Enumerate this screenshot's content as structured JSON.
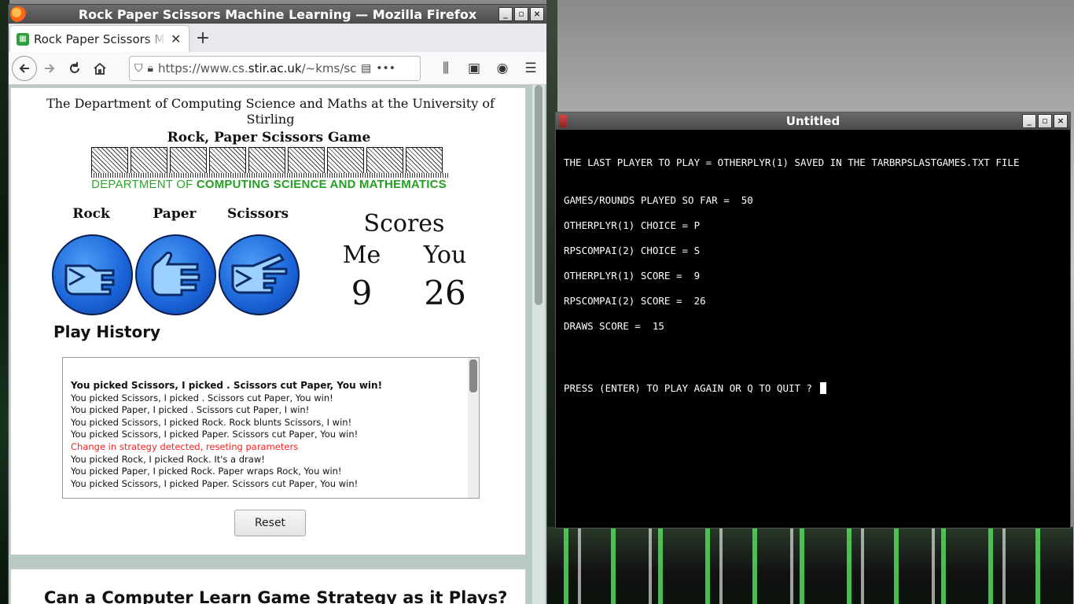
{
  "firefox": {
    "title": "Rock Paper Scissors Machine Learning — Mozilla Firefox",
    "tab_label": "Rock Paper Scissors Mac",
    "new_tab": "+",
    "url_prefix": "https://www.cs.",
    "url_domain": "stir.ac.uk",
    "url_suffix": "/~kms/scho",
    "more_icon": "•••",
    "win_buttons": {
      "minimize": "_",
      "maximize": "▫",
      "close": "×"
    }
  },
  "page": {
    "dept_line": "The Department of Computing Science and Maths at the University of Stirling",
    "game_title": "Rock, Paper Scissors Game",
    "banner_text_part1": "DEPARTMENT OF ",
    "banner_text_part2": "COMPUTING SCIENCE AND MATHEMATICS",
    "choices": {
      "rock": "Rock",
      "paper": "Paper",
      "scissors": "Scissors"
    },
    "scores": {
      "title": "Scores",
      "me_label": "Me",
      "you_label": "You",
      "me_value": "9",
      "you_value": "26"
    },
    "history_title": "Play History",
    "history": [
      {
        "text": "You picked Scissors, I picked . Scissors cut Paper, You win!",
        "style": "bold"
      },
      {
        "text": "You picked Scissors, I picked . Scissors cut Paper, You win!",
        "style": "normal"
      },
      {
        "text": "You picked Paper, I picked . Scissors cut Paper, I win!",
        "style": "normal"
      },
      {
        "text": "You picked Scissors, I picked Rock. Rock blunts Scissors, I win!",
        "style": "normal"
      },
      {
        "text": "You picked Scissors, I picked Paper. Scissors cut Paper, You win!",
        "style": "normal"
      },
      {
        "text": "Change in strategy detected, reseting parameters",
        "style": "red"
      },
      {
        "text": "You picked Rock, I picked Rock. It's a draw!",
        "style": "normal"
      },
      {
        "text": "You picked Paper, I picked Rock. Paper wraps Rock, You win!",
        "style": "normal"
      },
      {
        "text": "You picked Scissors, I picked Paper. Scissors cut Paper, You win!",
        "style": "normal"
      }
    ],
    "reset_label": "Reset",
    "next_heading": "Can a Computer Learn Game Strategy as it Plays?"
  },
  "terminal": {
    "title": "Untitled",
    "lines": [
      "THE LAST PLAYER TO PLAY = OTHERPLYR(1) SAVED IN THE TARBRPSLASTGAMES.TXT FILE",
      "GAMES/ROUNDS PLAYED SO FAR =  50",
      "OTHERPLYR(1) CHOICE = P",
      "RPSCOMPAI(2) CHOICE = S",
      "OTHERPLYR(1) SCORE =  9",
      "RPSCOMPAI(2) SCORE =  26",
      "DRAWS SCORE =  15",
      "PRESS (ENTER) TO PLAY AGAIN OR Q TO QUIT ? "
    ]
  },
  "colors": {
    "accent_green": "#2aaa2a",
    "history_red": "#ff2020",
    "hand_blue": "#1a63d8"
  }
}
